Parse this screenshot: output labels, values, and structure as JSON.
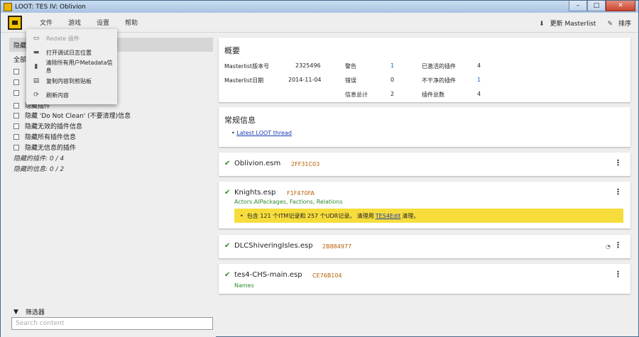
{
  "window": {
    "title": "LOOT: TES IV: Oblivion",
    "min": "–",
    "max": "□",
    "close": "✕"
  },
  "menu": [
    "文件",
    "游戏",
    "设置",
    "帮助"
  ],
  "toolbar": {
    "update_icon": "⬇",
    "update_label": "更新 Masterlist",
    "sort_icon": "✎",
    "sort_label": "排序"
  },
  "dropdown": [
    {
      "icon": "▭",
      "label": "Redate 插件",
      "disabled": true
    },
    {
      "icon": "▬",
      "label": "打开调试日志位置",
      "disabled": false
    },
    {
      "icon": "▮",
      "label": "清除所有用户Metadata信息",
      "disabled": false
    },
    {
      "icon": "▤",
      "label": "复制内容到剪贴板",
      "disabled": false
    },
    {
      "icon": "⟳",
      "label": "刷新内容",
      "disabled": false
    }
  ],
  "sidebar": {
    "sort_label": "隐藏",
    "all_label": "全部",
    "filters": [
      "隐藏 'Do Not Clean' (不要清理)信息",
      "隐藏无效的插件信息",
      "隐藏所有插件信息",
      "隐藏无信息的插件"
    ],
    "partial_filters": [
      "",
      "",
      "",
      "隐藏插件"
    ],
    "stats": [
      "隐藏的插件: 0 / 4",
      "隐藏的信息: 0 / 2"
    ],
    "filter_head": "筛选器",
    "search_placeholder": "Search content"
  },
  "summary": {
    "title": "概要",
    "rows": [
      {
        "label": "Masterlist版本号",
        "value": "2325496"
      },
      {
        "label": "Masterlist日期",
        "value": "2014-11-04"
      }
    ],
    "mid": [
      {
        "label": "警告",
        "value": "1"
      },
      {
        "label": "错误",
        "value": "0"
      },
      {
        "label": "信息总计",
        "value": "2"
      }
    ],
    "right": [
      {
        "label": "已激活的插件",
        "value": "4"
      },
      {
        "label": "不干净的插件",
        "value": "1"
      },
      {
        "label": "插件总数",
        "value": "4"
      }
    ]
  },
  "general": {
    "title": "常规信息",
    "link": "Latest LOOT thread"
  },
  "plugins": [
    {
      "name": "Oblivion.esm",
      "crc": "2FF31C03",
      "tags": "",
      "warning": null,
      "eye": false
    },
    {
      "name": "Knights.esp",
      "crc": "F1F470FA",
      "tags": "Actors.AIPackages, Factions, Relations",
      "warning": {
        "pre": "包含 121 个ITM记录和 257 个UDR记录。 清理用",
        "link": "TES4Edit",
        "post": "清理。"
      },
      "eye": false
    },
    {
      "name": "DLCShiveringIsles.esp",
      "crc": "2B884977",
      "tags": "",
      "warning": null,
      "eye": true
    },
    {
      "name": "tes4-CHS-main.esp",
      "crc": "CE76B104",
      "tags": "Names",
      "warning": null,
      "eye": false
    }
  ],
  "colors": {
    "accent": "#f2c200",
    "warning_bg": "#f6dd3c",
    "check": "#2e8b2e",
    "crc": "#b35c00"
  }
}
